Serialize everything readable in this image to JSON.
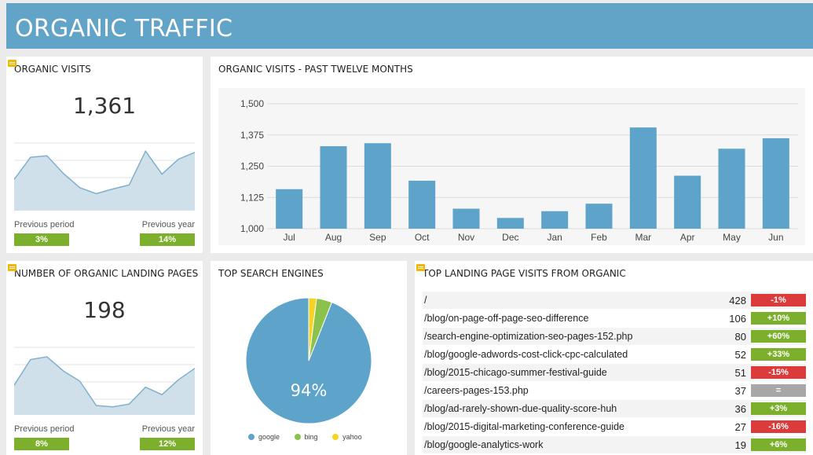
{
  "header": {
    "title": "ORGANIC TRAFFIC"
  },
  "organic_visits": {
    "title": "ORGANIC VISITS",
    "value": "1,361",
    "previous_period_label": "Previous period",
    "previous_period_change": "3%",
    "previous_year_label": "Previous year",
    "previous_year_change": "14%",
    "sparkline": [
      0.46,
      0.79,
      0.81,
      0.55,
      0.34,
      0.25,
      0.32,
      0.38,
      0.88,
      0.54,
      0.76,
      0.86
    ]
  },
  "monthly_chart": {
    "title": "ORGANIC VISITS - PAST TWELVE MONTHS",
    "chart_data": {
      "type": "bar",
      "categories": [
        "Jul",
        "Aug",
        "Sep",
        "Oct",
        "Nov",
        "Dec",
        "Jan",
        "Feb",
        "Mar",
        "Apr",
        "May",
        "Jun"
      ],
      "values": [
        1158,
        1330,
        1342,
        1192,
        1080,
        1043,
        1070,
        1100,
        1405,
        1212,
        1320,
        1362
      ],
      "y_ticks": [
        "1,000",
        "1,125",
        "1,250",
        "1,375",
        "1,500"
      ],
      "ylim": [
        1000,
        1500
      ],
      "grid": true,
      "color": "#5ea3c9"
    }
  },
  "landing_pages_count": {
    "title": "NUMBER OF ORGANIC LANDING PAGES",
    "value": "198",
    "previous_period_label": "Previous period",
    "previous_period_change": "8%",
    "previous_year_label": "Previous year",
    "previous_year_change": "12%",
    "sparkline": [
      0.44,
      0.82,
      0.86,
      0.65,
      0.5,
      0.14,
      0.12,
      0.16,
      0.41,
      0.3,
      0.52,
      0.69
    ]
  },
  "search_engines": {
    "title": "TOP SEARCH ENGINES",
    "center_label": "94%",
    "chart_data": {
      "type": "pie",
      "labels": [
        "google",
        "bing",
        "yahoo"
      ],
      "values": [
        94,
        4,
        2
      ],
      "colors": [
        "#5ea3c9",
        "#8bc34a",
        "#f5d327"
      ]
    }
  },
  "top_landing_pages": {
    "title": "TOP LANDING PAGE VISITS FROM ORGANIC",
    "rows": [
      {
        "path": "/",
        "visits": "428",
        "change": "-1%",
        "trend": "red"
      },
      {
        "path": "/blog/on-page-off-page-seo-difference",
        "visits": "106",
        "change": "+10%",
        "trend": "green"
      },
      {
        "path": "/search-engine-optimization-seo-pages-152.php",
        "visits": "80",
        "change": "+60%",
        "trend": "green"
      },
      {
        "path": "/blog/google-adwords-cost-click-cpc-calculated",
        "visits": "52",
        "change": "+33%",
        "trend": "green"
      },
      {
        "path": "/blog/2015-chicago-summer-festival-guide",
        "visits": "51",
        "change": "-15%",
        "trend": "red"
      },
      {
        "path": "/careers-pages-153.php",
        "visits": "37",
        "change": "=",
        "trend": "gray"
      },
      {
        "path": "/blog/ad-rarely-shown-due-quality-score-huh",
        "visits": "36",
        "change": "+3%",
        "trend": "green"
      },
      {
        "path": "/blog/2015-digital-marketing-conference-guide",
        "visits": "27",
        "change": "-16%",
        "trend": "red"
      },
      {
        "path": "/blog/google-analytics-work",
        "visits": "19",
        "change": "+6%",
        "trend": "green"
      }
    ]
  }
}
